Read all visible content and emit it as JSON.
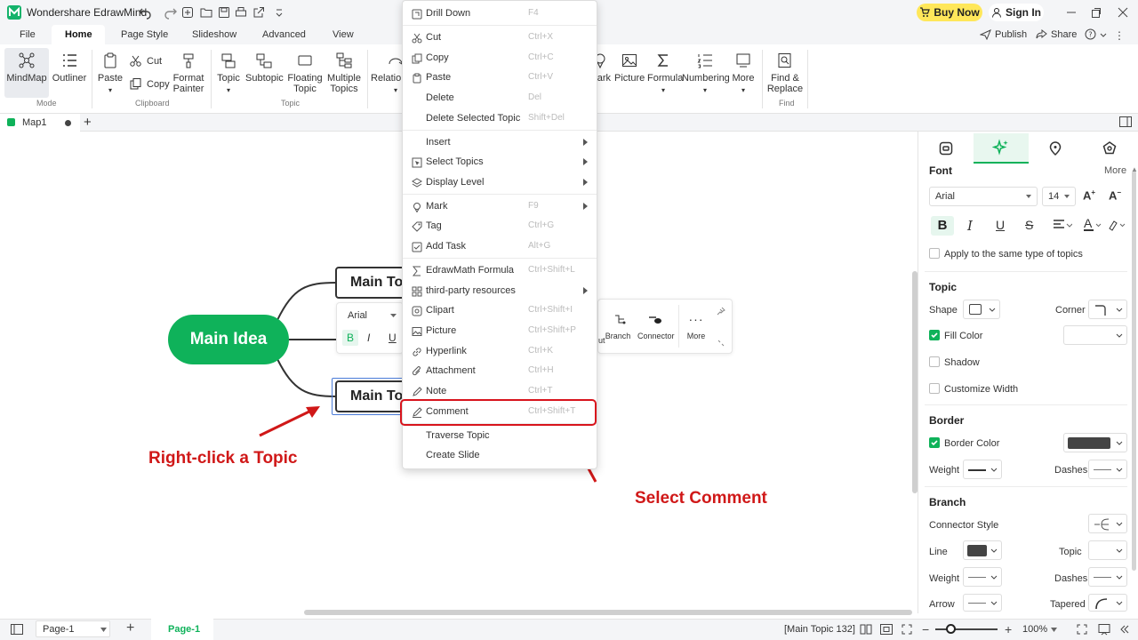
{
  "app": {
    "title": "Wondershare EdrawMind",
    "buy_now": "Buy Now",
    "sign_in": "Sign In"
  },
  "menu": {
    "tabs": [
      "File",
      "Home",
      "Page Style",
      "Slideshow",
      "Advanced",
      "View"
    ],
    "publish": "Publish",
    "share": "Share",
    "help": "?"
  },
  "ribbon": {
    "mindmap": "MindMap",
    "outliner": "Outliner",
    "mode_label": "Mode",
    "paste": "Paste",
    "cut": "Cut",
    "copy": "Copy",
    "format_painter_1": "Format",
    "format_painter_2": "Painter",
    "clipboard_label": "Clipboard",
    "topic": "Topic",
    "subtopic": "Subtopic",
    "floating_1": "Floating",
    "floating_2": "Topic",
    "multiple_1": "Multiple",
    "multiple_2": "Topics",
    "topic_label": "Topic",
    "relation": "Relation",
    "mark": "ark",
    "picture": "Picture",
    "formula": "Formula",
    "numbering": "Numbering",
    "more": "More",
    "find_1": "Find &",
    "find_2": "Replace",
    "find_label": "Find"
  },
  "doc": {
    "tab_name": "Map1"
  },
  "canvas": {
    "main_idea": "Main Idea",
    "topic1": "Main To",
    "topic2": "Main To",
    "float_font": "Arial",
    "float_b": "B",
    "float_i": "I",
    "float_u": "U",
    "float_items": [
      "ut",
      "Branch",
      "Connector",
      "More"
    ]
  },
  "context_menu": {
    "items": [
      {
        "label": "Drill Down",
        "shortcut": "F4",
        "icon": "drill-down-icon",
        "submenu": false
      },
      {
        "label": "Cut",
        "shortcut": "Ctrl+X",
        "icon": "cut-icon",
        "submenu": false
      },
      {
        "label": "Copy",
        "shortcut": "Ctrl+C",
        "icon": "copy-icon",
        "submenu": false
      },
      {
        "label": "Paste",
        "shortcut": "Ctrl+V",
        "icon": "paste-icon",
        "submenu": false
      },
      {
        "label": "Delete",
        "shortcut": "Del",
        "icon": "",
        "submenu": false
      },
      {
        "label": "Delete Selected Topic",
        "shortcut": "Shift+Del",
        "icon": "",
        "submenu": false
      },
      {
        "label": "Insert",
        "shortcut": "",
        "icon": "",
        "submenu": true
      },
      {
        "label": "Select Topics",
        "shortcut": "",
        "icon": "select-icon",
        "submenu": true
      },
      {
        "label": "Display Level",
        "shortcut": "",
        "icon": "layers-icon",
        "submenu": true
      },
      {
        "label": "Mark",
        "shortcut": "F9",
        "icon": "mark-icon",
        "submenu": true
      },
      {
        "label": "Tag",
        "shortcut": "Ctrl+G",
        "icon": "tag-icon",
        "submenu": false
      },
      {
        "label": "Add Task",
        "shortcut": "Alt+G",
        "icon": "task-icon",
        "submenu": false
      },
      {
        "label": "EdrawMath Formula",
        "shortcut": "Ctrl+Shift+L",
        "icon": "sigma-icon",
        "submenu": false
      },
      {
        "label": "third-party resources",
        "shortcut": "",
        "icon": "resources-icon",
        "submenu": true
      },
      {
        "label": "Clipart",
        "shortcut": "Ctrl+Shift+I",
        "icon": "clipart-icon",
        "submenu": false
      },
      {
        "label": "Picture",
        "shortcut": "Ctrl+Shift+P",
        "icon": "picture-icon",
        "submenu": false
      },
      {
        "label": "Hyperlink",
        "shortcut": "Ctrl+K",
        "icon": "link-icon",
        "submenu": false
      },
      {
        "label": "Attachment",
        "shortcut": "Ctrl+H",
        "icon": "attachment-icon",
        "submenu": false
      },
      {
        "label": "Note",
        "shortcut": "Ctrl+T",
        "icon": "note-icon",
        "submenu": false
      },
      {
        "label": "Comment",
        "shortcut": "Ctrl+Shift+T",
        "icon": "comment-icon",
        "submenu": false
      },
      {
        "label": "Traverse Topic",
        "shortcut": "",
        "icon": "",
        "submenu": false
      },
      {
        "label": "Create Slide",
        "shortcut": "",
        "icon": "",
        "submenu": false
      }
    ]
  },
  "annotations": {
    "right_click": "Right-click a Topic",
    "select_comment": "Select Comment"
  },
  "panel": {
    "font_title": "Font",
    "more": "More",
    "font_family": "Arial",
    "font_size": "14",
    "apply_same": "Apply to the same type of topics",
    "topic_title": "Topic",
    "shape": "Shape",
    "corner": "Corner",
    "fill_color": "Fill Color",
    "shadow": "Shadow",
    "customize_width": "Customize Width",
    "border_title": "Border",
    "border_color": "Border Color",
    "weight": "Weight",
    "dashes": "Dashes",
    "branch_title": "Branch",
    "connector_style": "Connector Style",
    "line": "Line",
    "topic": "Topic",
    "branch_weight": "Weight",
    "branch_dashes": "Dashes",
    "arrow": "Arrow",
    "tapered": "Tapered",
    "accent": "#0fb25a",
    "border_swatch": "#444444"
  },
  "status": {
    "page_select": "Page-1",
    "page_tab": "Page-1",
    "selection": "[Main Topic 132]",
    "zoom": "100%"
  }
}
